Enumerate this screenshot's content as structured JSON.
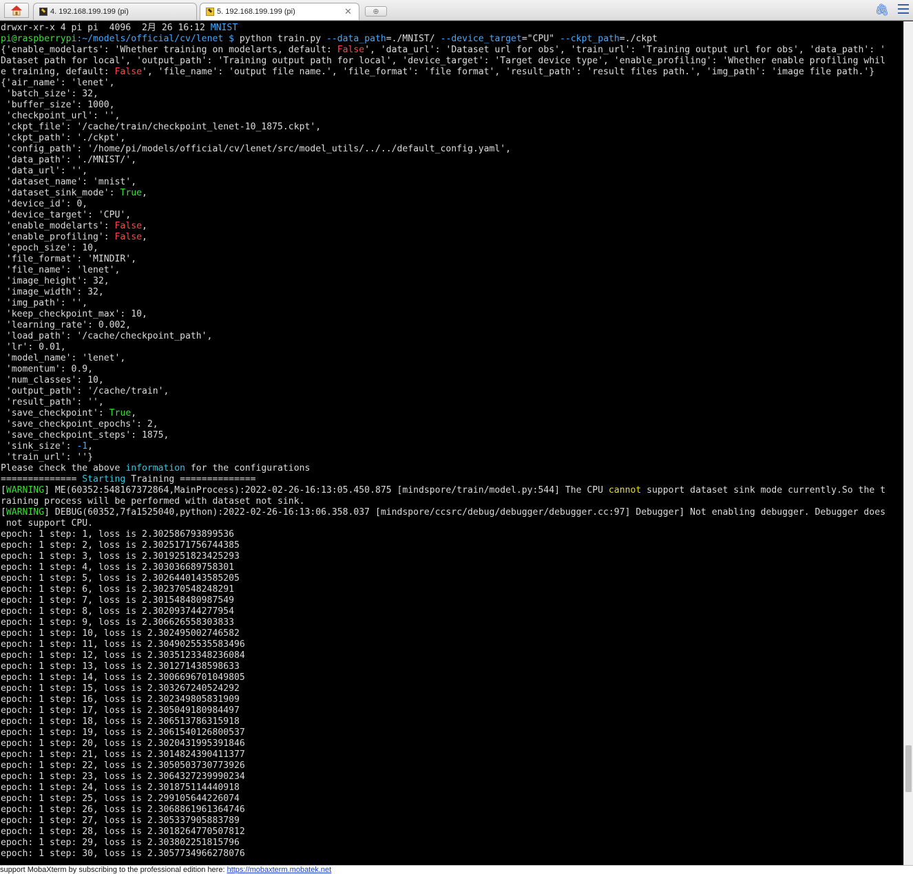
{
  "tabs": [
    {
      "label": "4. 192.168.199.199 (pi)",
      "active": false
    },
    {
      "label": "5. 192.168.199.199 (pi)",
      "active": true
    }
  ],
  "terminal": {
    "ls_line": {
      "perm": "drwxr-xr-x 4 pi pi  4096  2月 26 16:12 ",
      "dir": "MNIST"
    },
    "prompt": {
      "user": "pi@raspberrypi",
      "path": ":~/models/official/cv/lenet $ "
    },
    "command": {
      "cmd": "python train.py ",
      "args": [
        {
          "flag": "--data_path",
          "value": "=./MNIST/ "
        },
        {
          "flag": "--device_target",
          "value": "=\"CPU\" "
        },
        {
          "flag": "--ckpt_path",
          "value": "=./ckpt"
        }
      ]
    },
    "help_dict": {
      "l1a": "{'enable_modelarts': 'Whether training on modelarts, default: ",
      "l1b": "', 'data_url': 'Dataset url for obs', 'train_url': 'Training output url for obs', 'data_path': '",
      "l2": "Dataset path for local', 'output_path': 'Training output path for local', 'device_target': 'Target device type', 'enable_profiling': 'Whether enable profiling whil",
      "l3a": "e training, default: ",
      "l3b": "', 'file_name': 'output file name.', 'file_format': 'file format', 'result_path': 'result files path.', 'img_path': 'image file path.'}",
      "false_word": "False"
    },
    "config_lines": [
      {
        "text": "{'air_name': 'lenet',"
      },
      {
        "text": " 'batch_size': 32,"
      },
      {
        "text": " 'buffer_size': 1000,"
      },
      {
        "text": " 'checkpoint_url': '',"
      },
      {
        "text": " 'ckpt_file': '/cache/train/checkpoint_lenet-10_1875.ckpt',"
      },
      {
        "text": " 'ckpt_path': './ckpt',"
      },
      {
        "text": " 'config_path': '/home/pi/models/official/cv/lenet/src/model_utils/../../default_config.yaml',"
      },
      {
        "text": " 'data_path': './MNIST/',"
      },
      {
        "text": " 'data_url': '',"
      },
      {
        "text": " 'dataset_name': 'mnist',"
      },
      {
        "pre": " 'dataset_sink_mode': ",
        "val": "True",
        "post": ",",
        "color": "green"
      },
      {
        "text": " 'device_id': 0,"
      },
      {
        "text": " 'device_target': 'CPU',"
      },
      {
        "pre": " 'enable_modelarts': ",
        "val": "False",
        "post": ",",
        "color": "red"
      },
      {
        "pre": " 'enable_profiling': ",
        "val": "False",
        "post": ",",
        "color": "red"
      },
      {
        "text": " 'epoch_size': 10,"
      },
      {
        "text": " 'file_format': 'MINDIR',"
      },
      {
        "text": " 'file_name': 'lenet',"
      },
      {
        "text": " 'image_height': 32,"
      },
      {
        "text": " 'image_width': 32,"
      },
      {
        "text": " 'img_path': '',"
      },
      {
        "text": " 'keep_checkpoint_max': 10,"
      },
      {
        "text": " 'learning_rate': 0.002,"
      },
      {
        "text": " 'load_path': '/cache/checkpoint_path',"
      },
      {
        "text": " 'lr': 0.01,"
      },
      {
        "text": " 'model_name': 'lenet',"
      },
      {
        "text": " 'momentum': 0.9,"
      },
      {
        "text": " 'num_classes': 10,"
      },
      {
        "text": " 'output_path': '/cache/train',"
      },
      {
        "text": " 'result_path': '',"
      },
      {
        "pre": " 'save_checkpoint': ",
        "val": "True",
        "post": ",",
        "color": "green"
      },
      {
        "text": " 'save_checkpoint_epochs': 2,"
      },
      {
        "text": " 'save_checkpoint_steps': 1875,"
      },
      {
        "pre": " 'sink_size': ",
        "val": "-1",
        "post": ",",
        "color": "blue"
      },
      {
        "text": " 'train_url': ''}"
      }
    ],
    "check_line": {
      "pre": "Please check the above ",
      "word": "information",
      "post": " for the configurations"
    },
    "starting_line": {
      "eq": "============== ",
      "word": "Starting",
      "rest": " Training =============="
    },
    "warning_tag": "WARNING",
    "warning1": {
      "pre": "] ME(60352:548167372864,MainProcess):2022-02-26-16:13:05.450.875 [mindspore/train/model.py:544] The CPU ",
      "word": "cannot",
      "post": " support dataset sink mode currently.So the t",
      "cont": "raining process will be performed with dataset not sink."
    },
    "warning2": {
      "text": "] DEBUG(60352,7fa1525040,python):2022-02-26-16:13:06.358.037 [mindspore/ccsrc/debug/debugger/debugger.cc:97] Debugger] Not enabling debugger. Debugger does",
      "cont": " not support CPU."
    },
    "loss_lines": [
      "epoch: 1 step: 1, loss is 2.302586793899536",
      "epoch: 1 step: 2, loss is 2.3025171756744385",
      "epoch: 1 step: 3, loss is 2.3019251823425293",
      "epoch: 1 step: 4, loss is 2.303036689758301",
      "epoch: 1 step: 5, loss is 2.3026440143585205",
      "epoch: 1 step: 6, loss is 2.302370548248291",
      "epoch: 1 step: 7, loss is 2.301548480987549",
      "epoch: 1 step: 8, loss is 2.302093744277954",
      "epoch: 1 step: 9, loss is 2.306626558303833",
      "epoch: 1 step: 10, loss is 2.302495002746582",
      "epoch: 1 step: 11, loss is 2.3049025535583496",
      "epoch: 1 step: 12, loss is 2.3035123348236084",
      "epoch: 1 step: 13, loss is 2.301271438598633",
      "epoch: 1 step: 14, loss is 2.3006696701049805",
      "epoch: 1 step: 15, loss is 2.303267240524292",
      "epoch: 1 step: 16, loss is 2.302349805831909",
      "epoch: 1 step: 17, loss is 2.305049180984497",
      "epoch: 1 step: 18, loss is 2.306513786315918",
      "epoch: 1 step: 19, loss is 2.3061540126800537",
      "epoch: 1 step: 20, loss is 2.3020431995391846",
      "epoch: 1 step: 21, loss is 2.3014824390411377",
      "epoch: 1 step: 22, loss is 2.3050503730773926",
      "epoch: 1 step: 23, loss is 2.3064327239990234",
      "epoch: 1 step: 24, loss is 2.301875114440918",
      "epoch: 1 step: 25, loss is 2.299105644226074",
      "epoch: 1 step: 26, loss is 2.3068861961364746",
      "epoch: 1 step: 27, loss is 2.305337905883789",
      "epoch: 1 step: 28, loss is 2.3018264770507812",
      "epoch: 1 step: 29, loss is 2.303802251815796",
      "epoch: 1 step: 30, loss is 2.3057734966278076"
    ]
  },
  "statusbar": {
    "text": "support MobaXterm by subscribing to the professional edition here: ",
    "link": "https://mobaxterm.mobatek.net"
  },
  "colors": {
    "green": "#36e036",
    "blue": "#43a8ff",
    "cyan": "#2ec8e0",
    "red": "#ff4646",
    "yellow": "#e3e300"
  }
}
